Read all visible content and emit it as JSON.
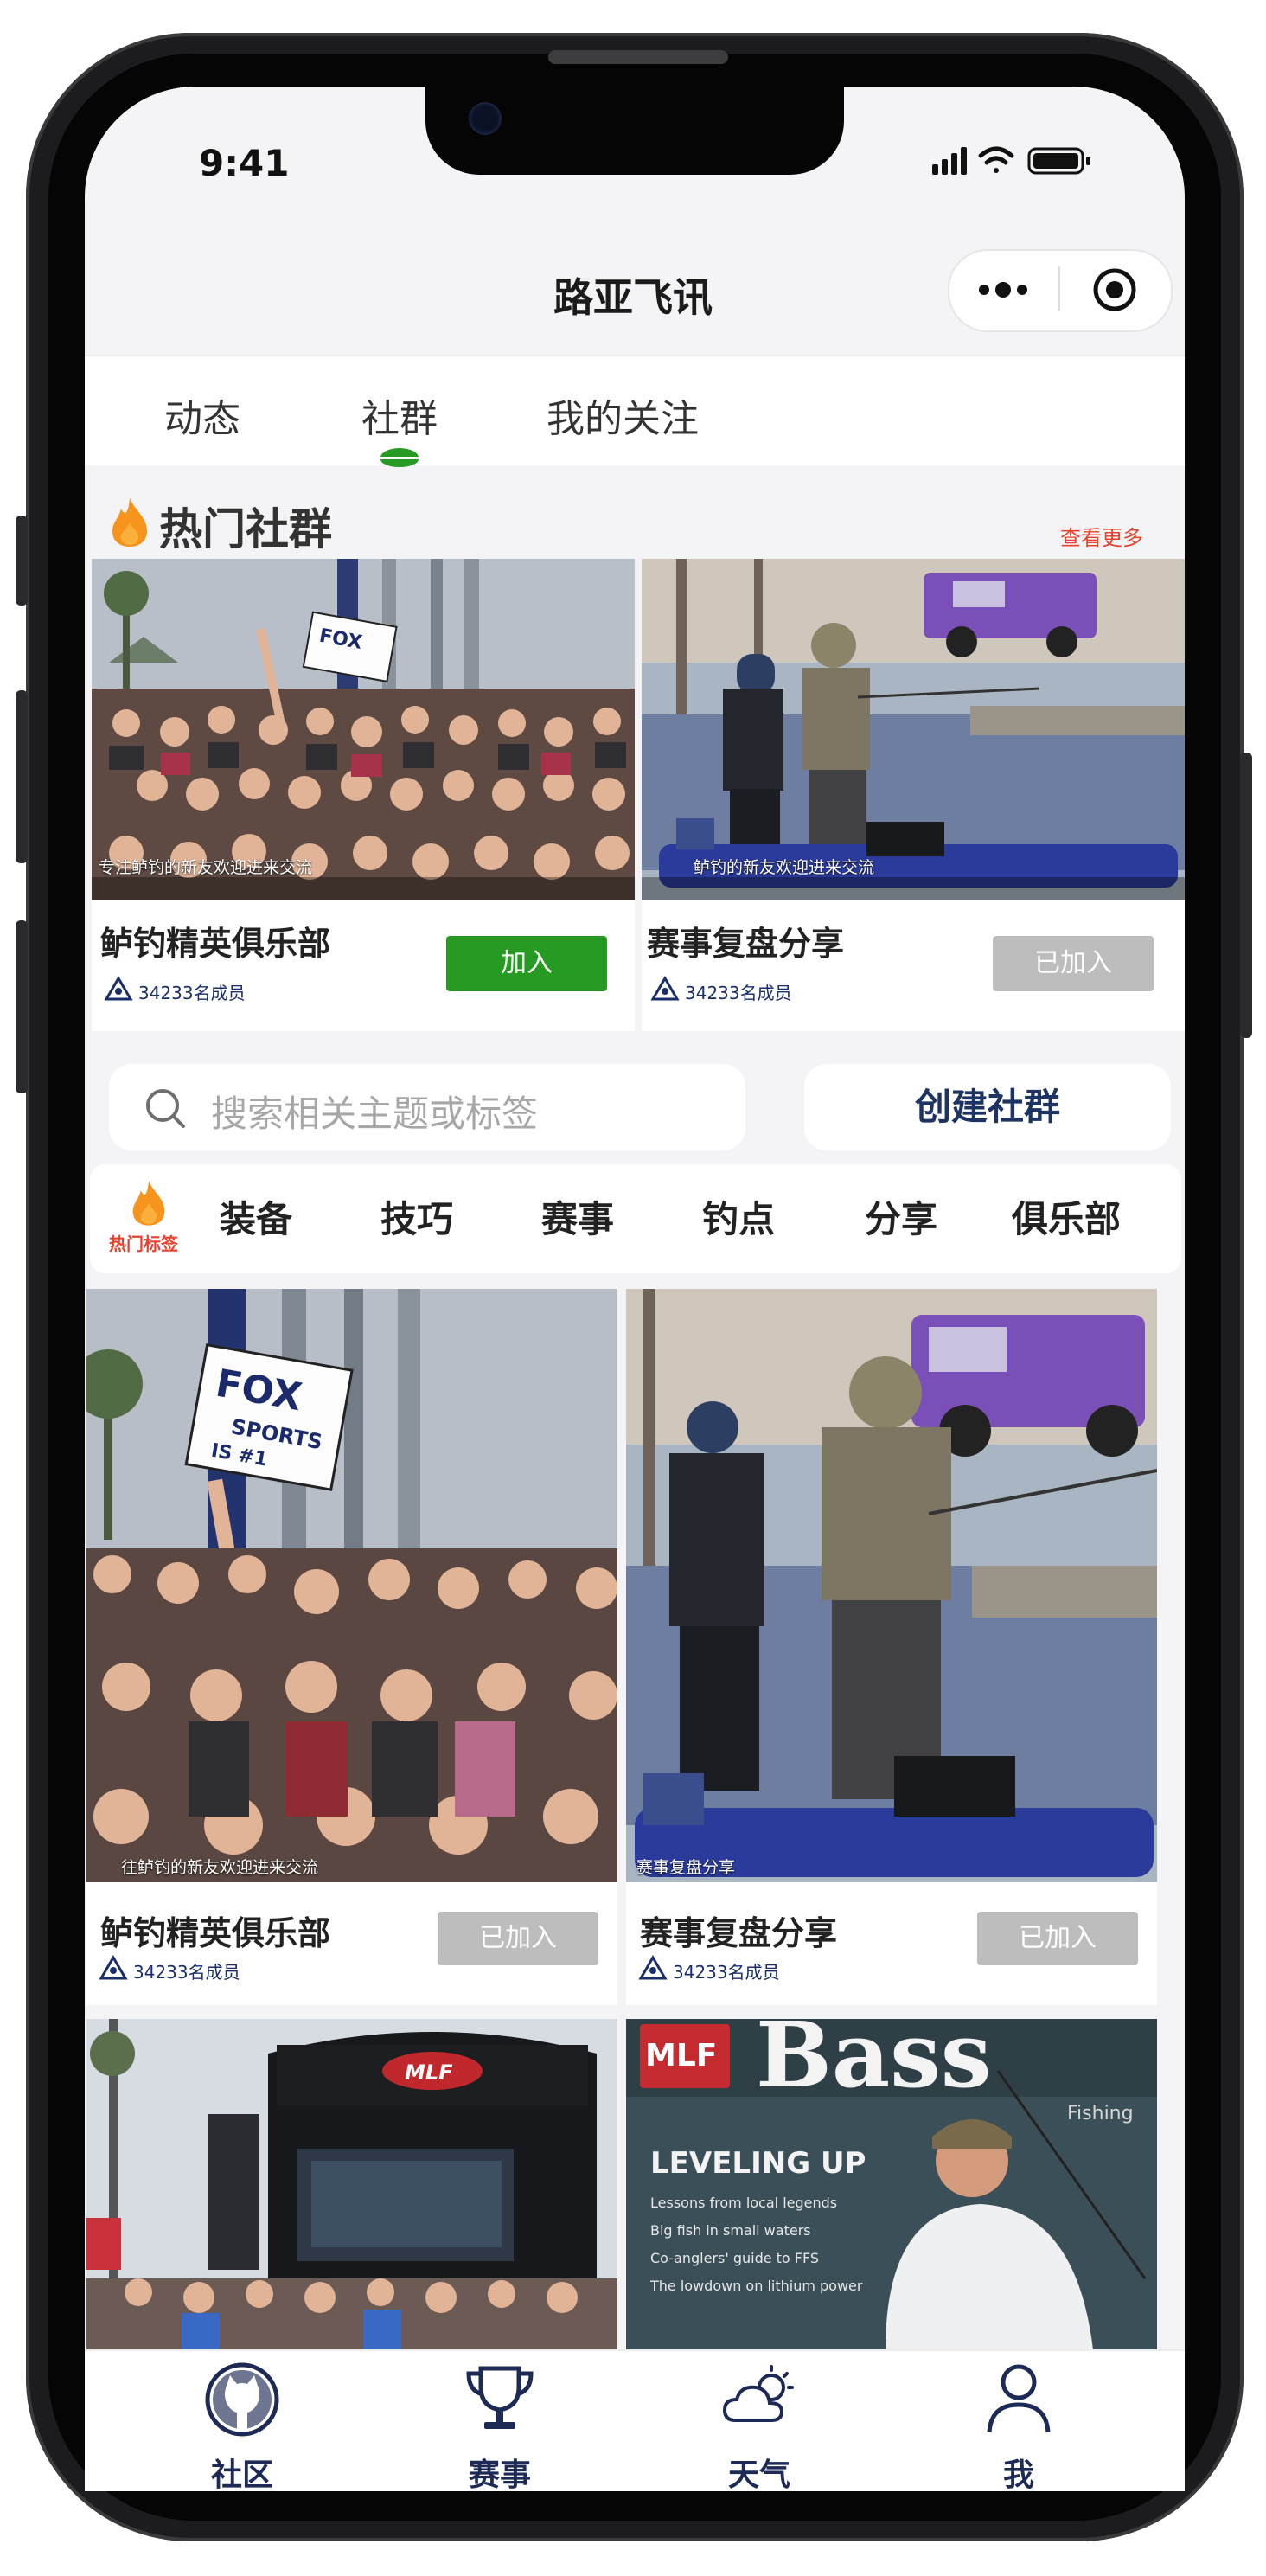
{
  "status": {
    "time": "9:41"
  },
  "header": {
    "title": "路亚飞讯"
  },
  "tabs": [
    {
      "label": "动态"
    },
    {
      "label": "社群"
    },
    {
      "label": "我的关注"
    }
  ],
  "hot": {
    "title": "热门社群",
    "see_more": "查看更多",
    "cards": [
      {
        "caption": "专注鲈钓的新友欢迎进来交流",
        "name": "鲈钓精英俱乐部",
        "members": "34233名成员",
        "button": "加入"
      },
      {
        "caption": "鲈钓的新友欢迎进来交流",
        "name": "赛事复盘分享",
        "members": "34233名成员",
        "button": "已加入"
      }
    ]
  },
  "search": {
    "placeholder": "搜索相关主题或标签",
    "create_label": "创建社群"
  },
  "tags": {
    "hot_label": "热门标签",
    "items": [
      "装备",
      "技巧",
      "赛事",
      "钓点",
      "分享",
      "俱乐部"
    ]
  },
  "feed": [
    {
      "caption": "往鲈钓的新友欢迎进来交流",
      "name": "鲈钓精英俱乐部",
      "members": "34233名成员",
      "button": "已加入"
    },
    {
      "caption": "赛事复盘分享",
      "name": "赛事复盘分享",
      "members": "34233名成员",
      "button": "已加入"
    }
  ],
  "photo_text": {
    "sign_line1": "FOX",
    "sign_line2": "SPORTS",
    "sign_line3": "IS #1",
    "mlf": "MLF",
    "bass": "Bass",
    "fishing": "Fishing",
    "leveling": "LEVELING UP",
    "bullets": [
      "Lessons from local legends",
      "Big fish in small waters",
      "Co-anglers' guide to FFS",
      "The lowdown on lithium power"
    ]
  },
  "bottom_nav": [
    {
      "label": "社区"
    },
    {
      "label": "赛事"
    },
    {
      "label": "天气"
    },
    {
      "label": "我"
    }
  ],
  "colors": {
    "accent_green": "#279a23",
    "joined_gray": "#bdbdbd",
    "see_more_red": "#e8432f",
    "navy": "#1d3361"
  }
}
